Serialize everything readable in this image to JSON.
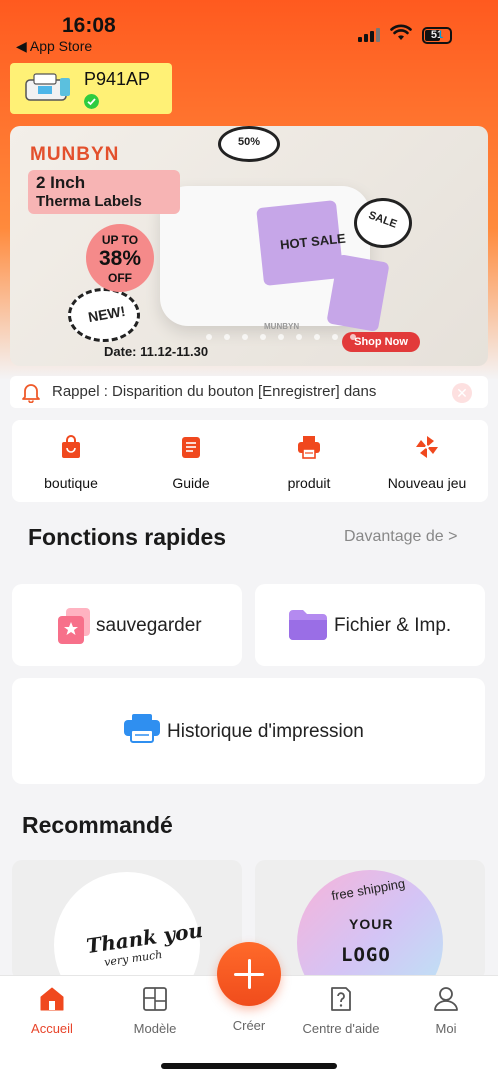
{
  "status_bar": {
    "time": "16:08",
    "back_label": "◀ App Store",
    "battery": "51"
  },
  "printer": {
    "name": "P941AP"
  },
  "banner": {
    "brand": "MUNBYN",
    "headline_line1": "2 Inch",
    "headline_line2": "Therma Labels",
    "discount_top": "UP TO",
    "discount_value": "38%",
    "discount_bottom": "OFF",
    "date": "Date: 11.12-11.30",
    "cta": "Shop Now",
    "sticker_hot": "HOT SALE",
    "sticker_new": "NEW!",
    "sticker_50": "50%",
    "sticker_sale": "SALE",
    "printer_brand": "MUNBYN"
  },
  "notice": {
    "text": "Rappel : Disparition du bouton [Enregistrer] dans"
  },
  "quick_links": [
    {
      "label": "boutique",
      "icon": "shopping-bag-icon"
    },
    {
      "label": "Guide",
      "icon": "book-icon"
    },
    {
      "label": "produit",
      "icon": "printer-icon"
    },
    {
      "label": "Nouveau jeu",
      "icon": "pinwheel-icon"
    }
  ],
  "quick_functions": {
    "title": "Fonctions rapides",
    "more": "Davantage de >",
    "save_label": "sauvegarder",
    "files_label": "Fichier & Imp.",
    "history_label": "Historique d'impression"
  },
  "recommended": {
    "title": "Recommandé",
    "card1_text1": "Thank you",
    "card1_text2": "very much",
    "card2_text1": "free shipping",
    "card2_text2": "YOUR",
    "card2_text3": "LOGO"
  },
  "tabs": [
    {
      "label": "Accueil",
      "icon": "home-icon",
      "active": true
    },
    {
      "label": "Modèle",
      "icon": "template-icon",
      "active": false
    },
    {
      "label": "Créer",
      "icon": "plus-icon",
      "active": false
    },
    {
      "label": "Centre d'aide",
      "icon": "help-icon",
      "active": false
    },
    {
      "label": "Moi",
      "icon": "profile-icon",
      "active": false
    }
  ],
  "colors": {
    "accent": "#f04c1c",
    "chip": "#fff176",
    "active_tab": "#e8442a"
  }
}
